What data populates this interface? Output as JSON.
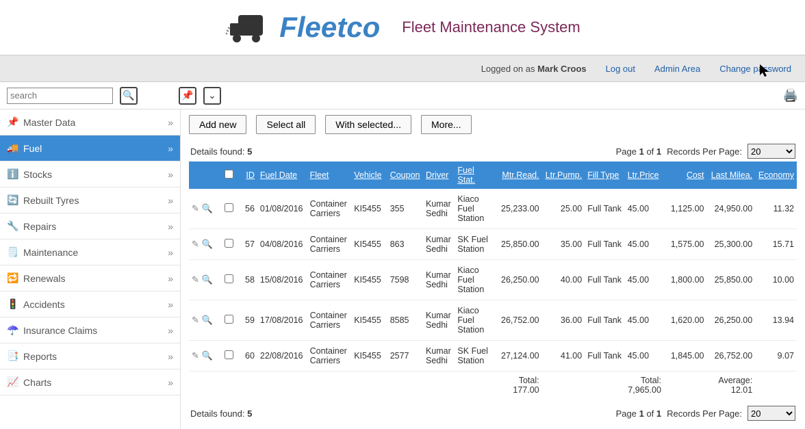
{
  "brand": "Fleetco",
  "tagline": "Fleet Maintenance System",
  "topbar": {
    "logged_prefix": "Logged on as ",
    "user": "Mark Croos",
    "logout": "Log out",
    "admin": "Admin Area",
    "changepw": "Change password"
  },
  "search_placeholder": "search",
  "sidebar": [
    {
      "icon": "📌",
      "label": "Master Data"
    },
    {
      "icon": "🚚",
      "label": "Fuel"
    },
    {
      "icon": "ℹ️",
      "label": "Stocks"
    },
    {
      "icon": "🔄",
      "label": "Rebuilt Tyres"
    },
    {
      "icon": "🔧",
      "label": "Repairs"
    },
    {
      "icon": "🗒️",
      "label": "Maintenance"
    },
    {
      "icon": "🔁",
      "label": "Renewals"
    },
    {
      "icon": "🚦",
      "label": "Accidents"
    },
    {
      "icon": "☂️",
      "label": "Insurance Claims"
    },
    {
      "icon": "📑",
      "label": "Reports"
    },
    {
      "icon": "📈",
      "label": "Charts"
    }
  ],
  "active_sidebar_index": 1,
  "actions": {
    "add": "Add new",
    "select_all": "Select all",
    "with_selected": "With selected...",
    "more": "More..."
  },
  "details_found_label": "Details found: ",
  "details_found": "5",
  "page_text_a": "Page ",
  "page_cur": "1",
  "page_text_b": " of ",
  "page_total": "1",
  "rpp_label": "Records Per Page:",
  "rpp_value": "20",
  "columns": [
    "ID",
    "Fuel Date",
    "Fleet",
    "Vehicle",
    "Coupon",
    "Driver",
    "Fuel Stat.",
    "Mtr.Read.",
    "Ltr.Pump.",
    "Fill Type",
    "Ltr.Price",
    "Cost",
    "Last Milea.",
    "Economy"
  ],
  "rows": [
    {
      "id": "56",
      "date": "01/08/2016",
      "fleet": "Container Carriers",
      "vehicle": "KI5455",
      "coupon": "355",
      "driver": "Kumar Sedhi",
      "station": "Kiaco Fuel Station",
      "mtr": "25,233.00",
      "ltr": "25.00",
      "fill": "Full Tank",
      "price": "45.00",
      "cost": "1,125.00",
      "last": "24,950.00",
      "econ": "11.32"
    },
    {
      "id": "57",
      "date": "04/08/2016",
      "fleet": "Container Carriers",
      "vehicle": "KI5455",
      "coupon": "863",
      "driver": "Kumar Sedhi",
      "station": "SK Fuel Station",
      "mtr": "25,850.00",
      "ltr": "35.00",
      "fill": "Full Tank",
      "price": "45.00",
      "cost": "1,575.00",
      "last": "25,300.00",
      "econ": "15.71"
    },
    {
      "id": "58",
      "date": "15/08/2016",
      "fleet": "Container Carriers",
      "vehicle": "KI5455",
      "coupon": "7598",
      "driver": "Kumar Sedhi",
      "station": "Kiaco Fuel Station",
      "mtr": "26,250.00",
      "ltr": "40.00",
      "fill": "Full Tank",
      "price": "45.00",
      "cost": "1,800.00",
      "last": "25,850.00",
      "econ": "10.00"
    },
    {
      "id": "59",
      "date": "17/08/2016",
      "fleet": "Container Carriers",
      "vehicle": "KI5455",
      "coupon": "8585",
      "driver": "Kumar Sedhi",
      "station": "Kiaco Fuel Station",
      "mtr": "26,752.00",
      "ltr": "36.00",
      "fill": "Full Tank",
      "price": "45.00",
      "cost": "1,620.00",
      "last": "26,250.00",
      "econ": "13.94"
    },
    {
      "id": "60",
      "date": "22/08/2016",
      "fleet": "Container Carriers",
      "vehicle": "KI5455",
      "coupon": "2577",
      "driver": "Kumar Sedhi",
      "station": "SK Fuel Station",
      "mtr": "27,124.00",
      "ltr": "41.00",
      "fill": "Full Tank",
      "price": "45.00",
      "cost": "1,845.00",
      "last": "26,752.00",
      "econ": "9.07"
    }
  ],
  "footer": {
    "ltr_total_label": "Total:",
    "ltr_total": "177.00",
    "cost_total_label": "Total:",
    "cost_total": "7,965.00",
    "econ_avg_label": "Average:",
    "econ_avg": "12.01"
  }
}
